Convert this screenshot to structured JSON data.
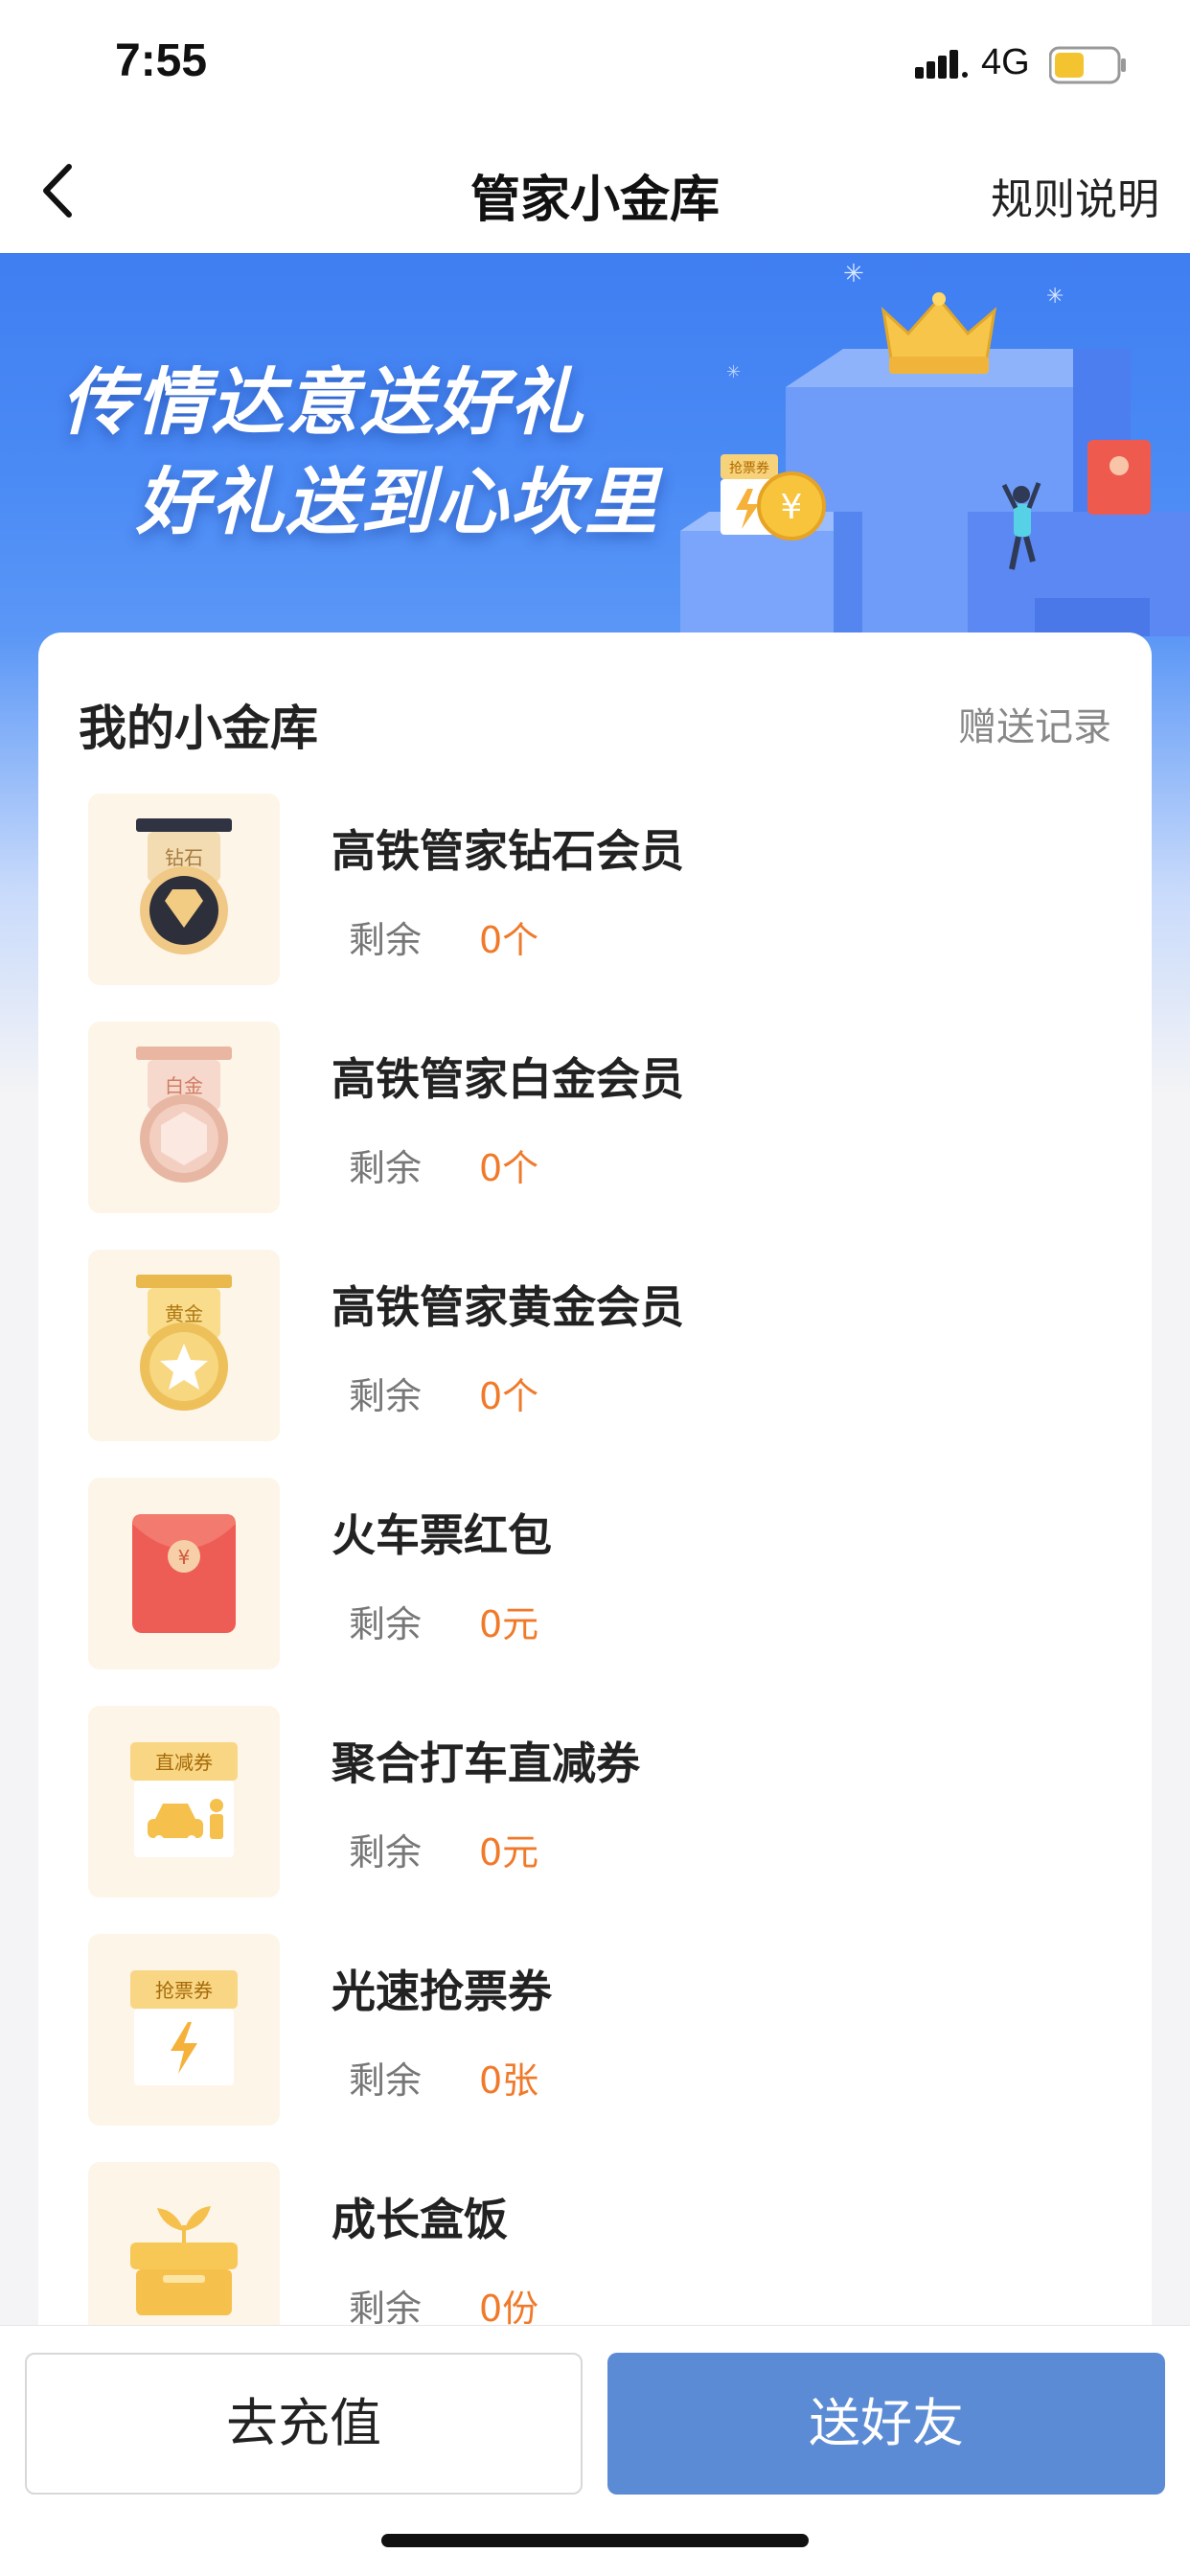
{
  "status_bar": {
    "time": "7:55",
    "network": "4G"
  },
  "nav": {
    "title": "管家小金库",
    "rules_label": "规则说明"
  },
  "banner": {
    "line1": "传情达意送好礼",
    "line2": "好礼送到心坎里",
    "coupon_tag": "抢票券"
  },
  "vault": {
    "title": "我的小金库",
    "records_label": "赠送记录",
    "items": [
      {
        "name": "高铁管家钻石会员",
        "remain_label": "剩余",
        "remain_value": "0个",
        "badge": "钻石",
        "icon": "diamond-medal-icon"
      },
      {
        "name": "高铁管家白金会员",
        "remain_label": "剩余",
        "remain_value": "0个",
        "badge": "白金",
        "icon": "platinum-medal-icon"
      },
      {
        "name": "高铁管家黄金会员",
        "remain_label": "剩余",
        "remain_value": "0个",
        "badge": "黄金",
        "icon": "gold-medal-icon"
      },
      {
        "name": "火车票红包",
        "remain_label": "剩余",
        "remain_value": "0元",
        "badge": "",
        "icon": "red-envelope-icon"
      },
      {
        "name": "聚合打车直减券",
        "remain_label": "剩余",
        "remain_value": "0元",
        "badge": "直减券",
        "icon": "taxi-coupon-icon"
      },
      {
        "name": "光速抢票券",
        "remain_label": "剩余",
        "remain_value": "0张",
        "badge": "抢票券",
        "icon": "fast-ticket-coupon-icon"
      },
      {
        "name": "成长盒饭",
        "remain_label": "剩余",
        "remain_value": "0份",
        "badge": "",
        "icon": "growth-lunchbox-icon"
      }
    ]
  },
  "actions": {
    "recharge_label": "去充值",
    "gift_label": "送好友"
  },
  "colors": {
    "accent_orange": "#f07a2a",
    "primary_blue": "#5c8bd6",
    "banner_blue": "#4b8bf5"
  }
}
